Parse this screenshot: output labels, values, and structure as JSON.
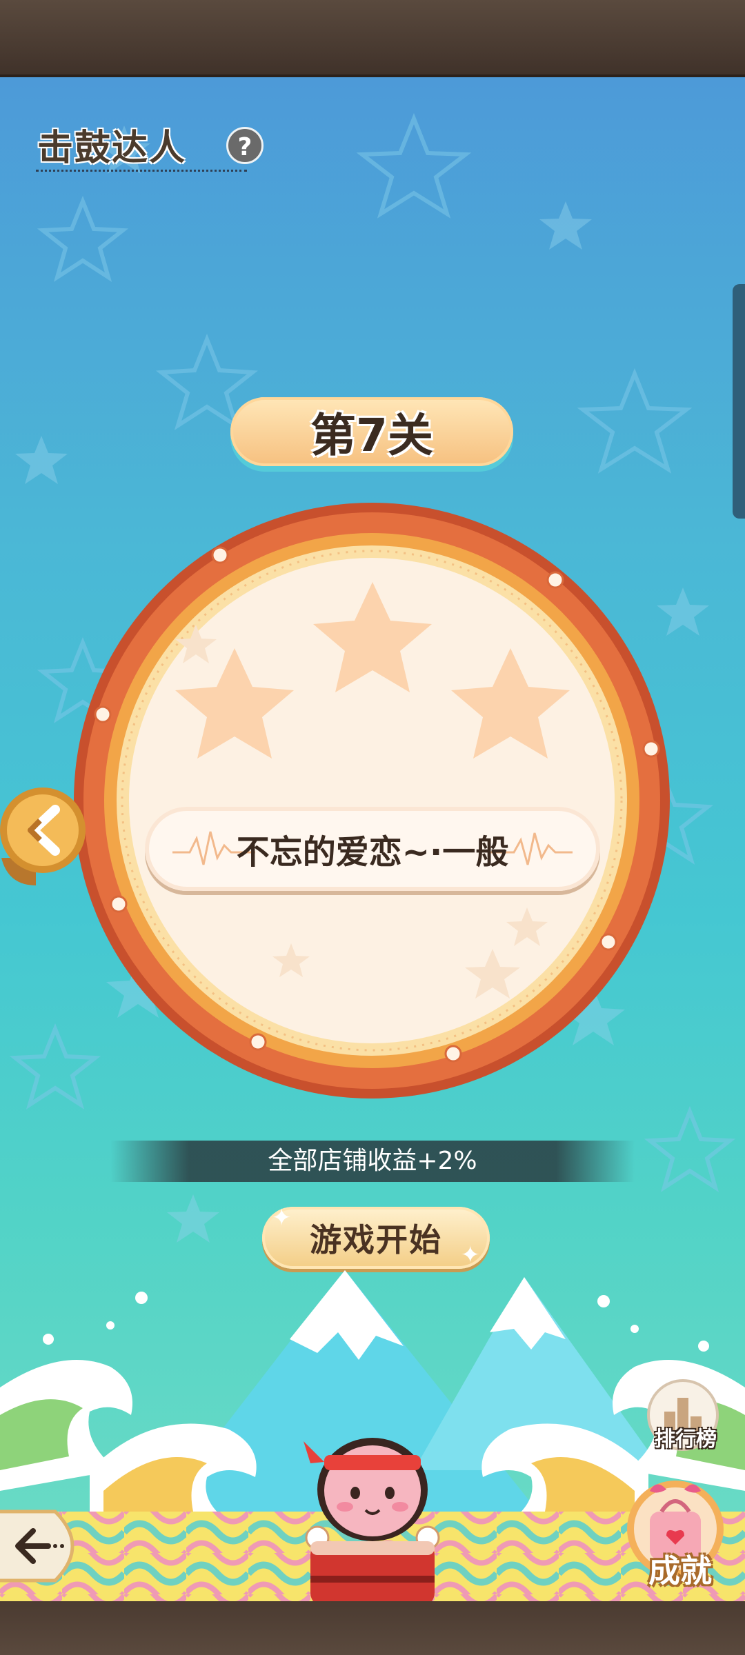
{
  "game": {
    "title": "击鼓达人",
    "help_symbol": "?"
  },
  "level": {
    "label": "第7关",
    "stars_earned": 0,
    "stars_total": 3
  },
  "song": {
    "name": "不忘的爱恋~·一般"
  },
  "bonus": {
    "text": "全部店铺收益+2%"
  },
  "buttons": {
    "start": "游戏开始",
    "leaderboard": "排行榜",
    "achievements": "成就"
  },
  "colors": {
    "sky_top": "#4d9ad8",
    "sky_bottom": "#6fdcc4",
    "drum_rim": "#d9683a",
    "drum_face": "#fdf1e3",
    "star_empty": "#fcd3ad"
  }
}
